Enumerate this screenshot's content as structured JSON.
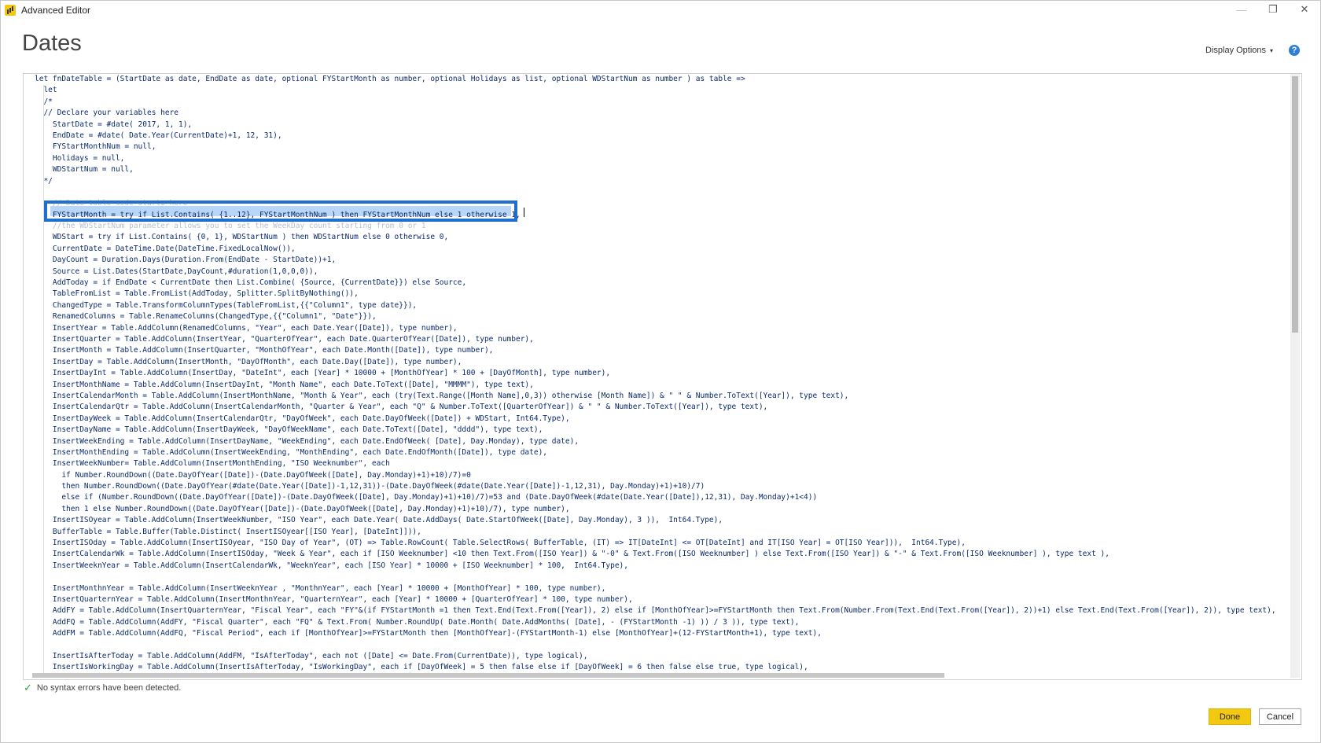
{
  "window": {
    "title": "Advanced Editor",
    "minimize": "—",
    "restore": "❐",
    "close": "✕"
  },
  "heading": "Dates",
  "display_options": {
    "label": "Display Options",
    "caret": "▾"
  },
  "help_icon": "?",
  "icons": {
    "app": "power-bi-icon",
    "help": "help-icon",
    "check": "check-icon"
  },
  "editor": {
    "lines": [
      "let fnDateTable = (StartDate as date, EndDate as date, optional FYStartMonth as number, optional Holidays as list, optional WDStartNum as number ) as table =>",
      "  let",
      "  /*",
      "  // Declare your variables here",
      "    StartDate = #date( 2017, 1, 1),",
      "    EndDate = #date( Date.Year(CurrentDate)+1, 12, 31),",
      "    FYStartMonthNum = null,",
      "    Holidays = null,",
      "    WDStartNum = null,",
      "  */",
      "",
      "    // Date table code starts here",
      "    FYStartMonth = try if List.Contains( {1..12}, FYStartMonthNum ) then FYStartMonthNum else 1 otherwise 1,",
      "    //the WDStartNum parameter allows you to set the WeekDay count starting from 0 or 1",
      "    WDStart = try if List.Contains( {0, 1}, WDStartNum ) then WDStartNum else 0 otherwise 0,",
      "    CurrentDate = DateTime.Date(DateTime.FixedLocalNow()),",
      "    DayCount = Duration.Days(Duration.From(EndDate - StartDate))+1,",
      "    Source = List.Dates(StartDate,DayCount,#duration(1,0,0,0)),",
      "    AddToday = if EndDate < CurrentDate then List.Combine( {Source, {CurrentDate}}) else Source,",
      "    TableFromList = Table.FromList(AddToday, Splitter.SplitByNothing()),",
      "    ChangedType = Table.TransformColumnTypes(TableFromList,{{\"Column1\", type date}}),",
      "    RenamedColumns = Table.RenameColumns(ChangedType,{{\"Column1\", \"Date\"}}),",
      "    InsertYear = Table.AddColumn(RenamedColumns, \"Year\", each Date.Year([Date]), type number),",
      "    InsertQuarter = Table.AddColumn(InsertYear, \"QuarterOfYear\", each Date.QuarterOfYear([Date]), type number),",
      "    InsertMonth = Table.AddColumn(InsertQuarter, \"MonthOfYear\", each Date.Month([Date]), type number),",
      "    InsertDay = Table.AddColumn(InsertMonth, \"DayOfMonth\", each Date.Day([Date]), type number),",
      "    InsertDayInt = Table.AddColumn(InsertDay, \"DateInt\", each [Year] * 10000 + [MonthOfYear] * 100 + [DayOfMonth], type number),",
      "    InsertMonthName = Table.AddColumn(InsertDayInt, \"Month Name\", each Date.ToText([Date], \"MMMM\"), type text),",
      "    InsertCalendarMonth = Table.AddColumn(InsertMonthName, \"Month & Year\", each (try(Text.Range([Month Name],0,3)) otherwise [Month Name]) & \" \" & Number.ToText([Year]), type text),",
      "    InsertCalendarQtr = Table.AddColumn(InsertCalendarMonth, \"Quarter & Year\", each \"Q\" & Number.ToText([QuarterOfYear]) & \" \" & Number.ToText([Year]), type text),",
      "    InsertDayWeek = Table.AddColumn(InsertCalendarQtr, \"DayOfWeek\", each Date.DayOfWeek([Date]) + WDStart, Int64.Type),",
      "    InsertDayName = Table.AddColumn(InsertDayWeek, \"DayOfWeekName\", each Date.ToText([Date], \"dddd\"), type text),",
      "    InsertWeekEnding = Table.AddColumn(InsertDayName, \"WeekEnding\", each Date.EndOfWeek( [Date], Day.Monday), type date),",
      "    InsertMonthEnding = Table.AddColumn(InsertWeekEnding, \"MonthEnding\", each Date.EndOfMonth([Date]), type date),",
      "    InsertWeekNumber= Table.AddColumn(InsertMonthEnding, \"ISO Weeknumber\", each",
      "      if Number.RoundDown((Date.DayOfYear([Date])-(Date.DayOfWeek([Date], Day.Monday)+1)+10)/7)=0",
      "      then Number.RoundDown((Date.DayOfYear(#date(Date.Year([Date])-1,12,31))-(Date.DayOfWeek(#date(Date.Year([Date])-1,12,31), Day.Monday)+1)+10)/7)",
      "      else if (Number.RoundDown((Date.DayOfYear([Date])-(Date.DayOfWeek([Date], Day.Monday)+1)+10)/7)=53 and (Date.DayOfWeek(#date(Date.Year([Date]),12,31), Day.Monday)+1<4))",
      "      then 1 else Number.RoundDown((Date.DayOfYear([Date])-(Date.DayOfWeek([Date], Day.Monday)+1)+10)/7), type number),",
      "    InsertISOyear = Table.AddColumn(InsertWeekNumber, \"ISO Year\", each Date.Year( Date.AddDays( Date.StartOfWeek([Date], Day.Monday), 3 )),  Int64.Type),",
      "    BufferTable = Table.Buffer(Table.Distinct( InsertISOyear[[ISO Year], [DateInt]])),",
      "    InsertISOday = Table.AddColumn(InsertISOyear, \"ISO Day of Year\", (OT) => Table.RowCount( Table.SelectRows( BufferTable, (IT) => IT[DateInt] <= OT[DateInt] and IT[ISO Year] = OT[ISO Year])),  Int64.Type),",
      "    InsertCalendarWk = Table.AddColumn(InsertISOday, \"Week & Year\", each if [ISO Weeknumber] <10 then Text.From([ISO Year]) & \"-0\" & Text.From([ISO Weeknumber] ) else Text.From([ISO Year]) & \"-\" & Text.From([ISO Weeknumber] ), type text ),",
      "    InsertWeeknYear = Table.AddColumn(InsertCalendarWk, \"WeeknYear\", each [ISO Year] * 10000 + [ISO Weeknumber] * 100,  Int64.Type),",
      "",
      "    InsertMonthnYear = Table.AddColumn(InsertWeeknYear , \"MonthnYear\", each [Year] * 10000 + [MonthOfYear] * 100, type number),",
      "    InsertQuarternYear = Table.AddColumn(InsertMonthnYear, \"QuarternYear\", each [Year] * 10000 + [QuarterOfYear] * 100, type number),",
      "    AddFY = Table.AddColumn(InsertQuarternYear, \"Fiscal Year\", each \"FY\"&(if FYStartMonth =1 then Text.End(Text.From([Year]), 2) else if [MonthOfYear]>=FYStartMonth then Text.From(Number.From(Text.End(Text.From([Year]), 2))+1) else Text.End(Text.From([Year]), 2)), type text),",
      "    AddFQ = Table.AddColumn(AddFY, \"Fiscal Quarter\", each \"FQ\" & Text.From( Number.RoundUp( Date.Month( Date.AddMonths( [Date], - (FYStartMonth -1) )) / 3 )), type text),",
      "    AddFM = Table.AddColumn(AddFQ, \"Fiscal Period\", each if [MonthOfYear]>=FYStartMonth then [MonthOfYear]-(FYStartMonth-1) else [MonthOfYear]+(12-FYStartMonth+1), type text),",
      "",
      "    InsertIsAfterToday = Table.AddColumn(AddFM, \"IsAfterToday\", each not ([Date] <= Date.From(CurrentDate)), type logical),",
      "    InsertIsWorkingDay = Table.AddColumn(InsertIsAfterToday, \"IsWorkingDay\", each if [DayOfWeek] = 5 then false else if [DayOfWeek] = 6 then false else true, type logical),"
    ]
  },
  "status": "No syntax errors have been detected.",
  "buttons": {
    "done": "Done",
    "cancel": "Cancel"
  }
}
